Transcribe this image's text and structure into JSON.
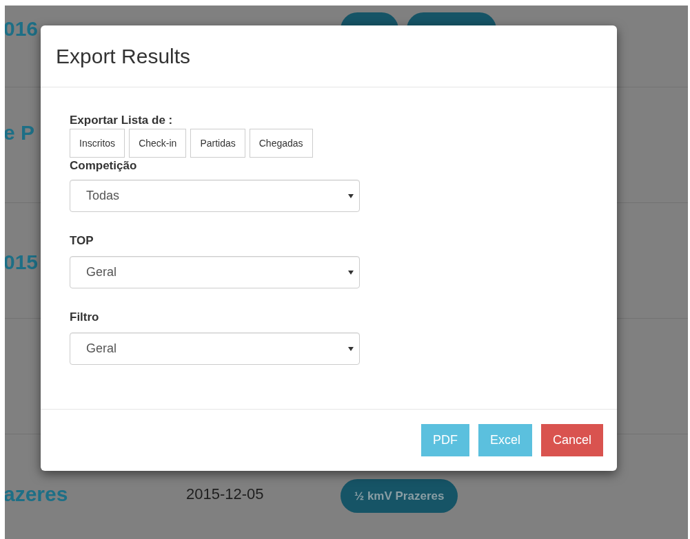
{
  "page": {
    "rows": [
      {
        "title": "016",
        "tags_hidden": true
      },
      {
        "title": "e P"
      },
      {
        "title": "015"
      },
      {},
      {
        "title": "azeres",
        "date": "2015-12-05",
        "tags": [
          "½ kmV Prazeres"
        ]
      }
    ]
  },
  "modal": {
    "title": "Export Results",
    "export_list": {
      "label": "Exportar Lista de :",
      "options": [
        "Inscritos",
        "Check-in",
        "Partidas",
        "Chegadas"
      ]
    },
    "fields": [
      {
        "label": "Competição",
        "value": "Todas"
      },
      {
        "label": "TOP",
        "value": "Geral"
      },
      {
        "label": "Filtro",
        "value": "Geral"
      }
    ],
    "buttons": [
      {
        "label": "PDF",
        "kind": "info"
      },
      {
        "label": "Excel",
        "kind": "info"
      },
      {
        "label": "Cancel",
        "kind": "danger"
      }
    ]
  }
}
